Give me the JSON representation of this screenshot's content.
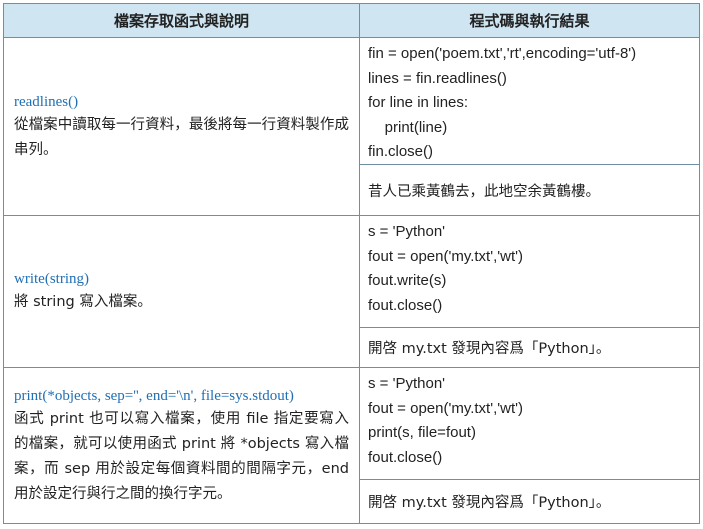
{
  "header": {
    "left": "檔案存取函式與說明",
    "right": "程式碼與執行結果"
  },
  "rows": [
    {
      "func": "readlines()",
      "desc": "從檔案中讀取每一行資料，最後將每一行資料製作成串列。",
      "code": [
        "fin = open('poem.txt','rt',encoding='utf-8')",
        "lines = fin.readlines()",
        "for line in lines:",
        "    print(line)",
        "fin.close()"
      ],
      "result": "昔人已乘黃鶴去，此地空余黃鶴樓。"
    },
    {
      "func": "write(string)",
      "desc": "將 string 寫入檔案。",
      "code": [
        "s = 'Python'",
        "fout = open('my.txt','wt')",
        "fout.write(s)",
        "fout.close()"
      ],
      "result": "開啓 my.txt 發現內容爲「Python」。"
    },
    {
      "func": "print(*objects, sep='', end='\\n', file=sys.stdout)",
      "desc": "函式 print 也可以寫入檔案，使用 file 指定要寫入的檔案，就可以使用函式 print 將 *objects 寫入檔案，而 sep 用於設定每個資料間的間隔字元，end 用於設定行與行之間的換行字元。",
      "code": [
        "s = 'Python'",
        "fout = open('my.txt','wt')",
        "print(s, file=fout)",
        "fout.close()"
      ],
      "result": "開啓 my.txt 發現內容爲「Python」。"
    }
  ]
}
